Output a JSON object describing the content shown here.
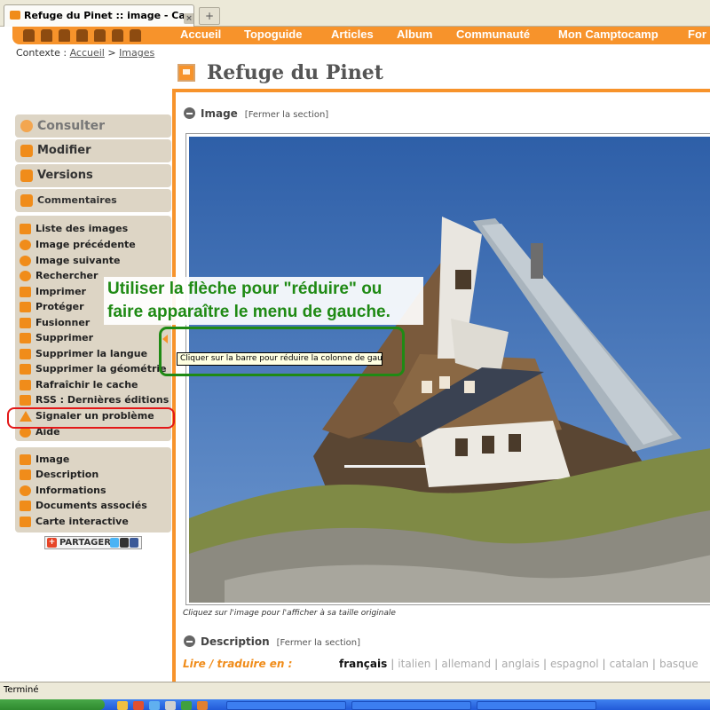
{
  "browser": {
    "tab_title": "Refuge du Pinet :: image - Camptoca...",
    "tab_close": "×",
    "new_tab": "+"
  },
  "nav": {
    "items": [
      "Accueil",
      "Topoguide",
      "Articles",
      "Album",
      "Communauté",
      "Mon Camptocamp",
      "For"
    ]
  },
  "context": {
    "label": "Contexte :",
    "home": "Accueil",
    "separator": ">",
    "current": "Images"
  },
  "page": {
    "title": "Refuge du Pinet"
  },
  "sidebar": {
    "main": [
      "Consulter",
      "Modifier",
      "Versions",
      "Commentaires"
    ],
    "actions": [
      "Liste des images",
      "Image précédente",
      "Image suivante",
      "Rechercher",
      "Imprimer",
      "Protéger",
      "Fusionner",
      "Supprimer",
      "Supprimer la langue",
      "Supprimer la géométrie",
      "Rafraîchir le cache",
      "RSS : Dernières éditions",
      "Signaler un problème",
      "Aide"
    ],
    "sections": [
      "Image",
      "Description",
      "Informations",
      "Documents associés",
      "Carte interactive"
    ],
    "share_label": "PARTAGER"
  },
  "image_section": {
    "title": "Image",
    "close_link": "[Fermer la section]",
    "caption": "Cliquez sur l'image pour l'afficher à sa taille originale"
  },
  "description_section": {
    "title": "Description",
    "close_link": "[Fermer la section]"
  },
  "languages": {
    "label": "Lire / traduire en :",
    "items": [
      "français",
      "italien",
      "allemand",
      "anglais",
      "espagnol",
      "catalan",
      "basque"
    ],
    "active": "français"
  },
  "annotation": {
    "text": "Utiliser la flèche pour \"réduire\" ou faire apparaître le menu de gauche."
  },
  "tooltip": {
    "text": "Cliquer sur la barre pour réduire la colonne de gauche"
  },
  "statusbar": {
    "text": "Terminé"
  },
  "colors": {
    "accent": "#f7932b",
    "sidebar_bg": "#ddd5c5",
    "annotation_green": "#1f8a14",
    "highlight_red": "#e31818"
  }
}
